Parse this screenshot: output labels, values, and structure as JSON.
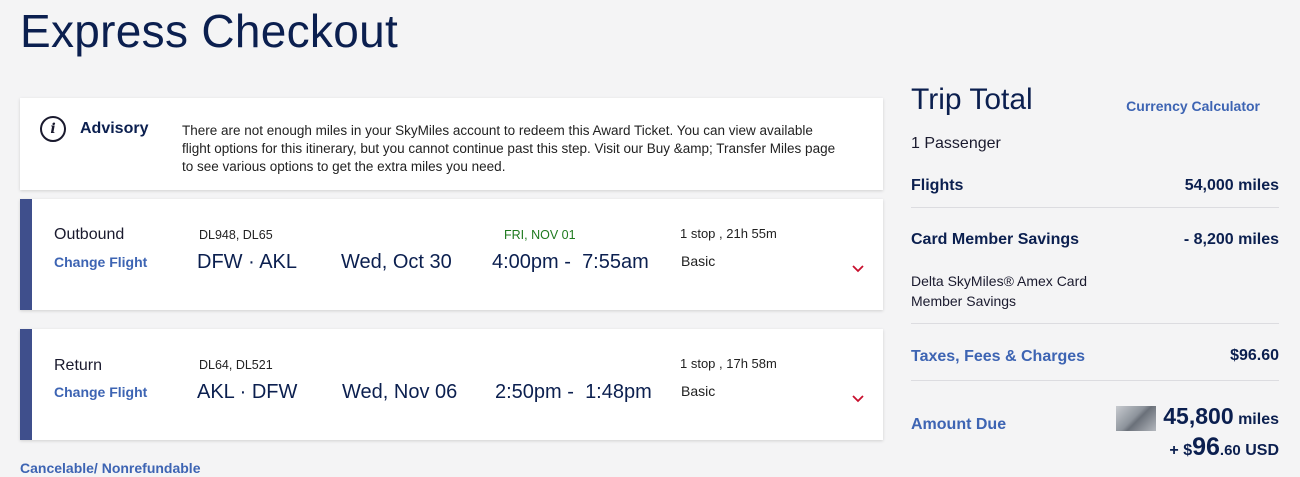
{
  "page": {
    "title": "Express Checkout"
  },
  "advisory": {
    "icon": "info-icon",
    "title": "Advisory",
    "message": "There are not enough miles in your SkyMiles account to redeem this Award Ticket. You can view available flight options for this itinerary, but you cannot continue past this step. Visit our Buy &amp; Transfer Miles page to see various options to get the extra miles you need."
  },
  "flights": [
    {
      "direction": "Outbound",
      "change_label": "Change Flight",
      "flight_numbers": "DL948, DL65",
      "route": "DFW · AKL",
      "date": "Wed, Oct 30",
      "arrival_note": "FRI, NOV 01",
      "depart": "4:00pm",
      "arrive": "7:55am",
      "stops": "1 stop  , 21h 55m",
      "cabin": "Basic"
    },
    {
      "direction": "Return",
      "change_label": "Change Flight",
      "flight_numbers": "DL64, DL521",
      "route": "AKL · DFW",
      "date": "Wed, Nov 06",
      "arrival_note": "",
      "depart": "2:50pm",
      "arrive": "1:48pm",
      "stops": "1 stop  , 17h 58m",
      "cabin": "Basic"
    }
  ],
  "fare_note": "Cancelable/ Nonrefundable",
  "trip_total": {
    "title": "Trip Total",
    "currency_calculator": "Currency Calculator",
    "passengers": "1 Passenger",
    "flights_label": "Flights",
    "flights_value": "54,000 miles",
    "savings_label": "Card Member Savings",
    "savings_value": "- 8,200 miles",
    "savings_desc": "Delta SkyMiles® Amex Card Member Savings",
    "taxes_label": "Taxes, Fees & Charges",
    "taxes_value": "$96.60",
    "amount_due_label": "Amount Due",
    "due_miles": "45,800",
    "due_miles_unit": "miles",
    "due_plus": "+ $",
    "due_dollars": "96",
    "due_cents": ".60",
    "due_currency": "USD"
  },
  "colors": {
    "accent": "#3f4f8c",
    "link": "#3d64b3",
    "title": "#0b1f4f",
    "arrival_green": "#1f7a1f",
    "chevron": "#c8102e"
  }
}
